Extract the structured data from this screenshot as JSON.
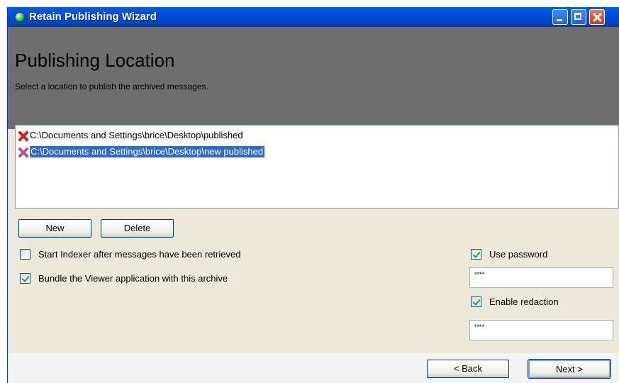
{
  "window": {
    "title": "Retain Publishing Wizard",
    "controls": [
      "minimize-icon",
      "maximize-icon",
      "close-icon"
    ]
  },
  "header": {
    "title": "Publishing Location",
    "subtitle": "Select a location to publish the archived messages."
  },
  "locations": [
    {
      "path": "C:\\Documents and Settings\\brice\\Desktop\\published",
      "selected": false,
      "icon": "delete-x-icon"
    },
    {
      "path": "C:\\Documents and Settings\\brice\\Desktop\\new published",
      "selected": true,
      "icon": "delete-x-icon"
    }
  ],
  "buttons": {
    "new": "New",
    "delete": "Delete",
    "back": "< Back",
    "next": "Next >"
  },
  "options": {
    "start_indexer": {
      "label": "Start Indexer after messages have been retrieved",
      "checked": false
    },
    "bundle_viewer": {
      "label": "Bundle the Viewer application with this archive",
      "checked": true
    },
    "use_password": {
      "label": "Use password",
      "checked": true,
      "value": "****"
    },
    "enable_redaction": {
      "label": "Enable redaction",
      "checked": true,
      "value": "****"
    }
  },
  "colors": {
    "titlebar": "#0554e3",
    "header_bg": "#6e6e6e",
    "selection": "#3169c6",
    "window_bg": "#ece9d8"
  }
}
